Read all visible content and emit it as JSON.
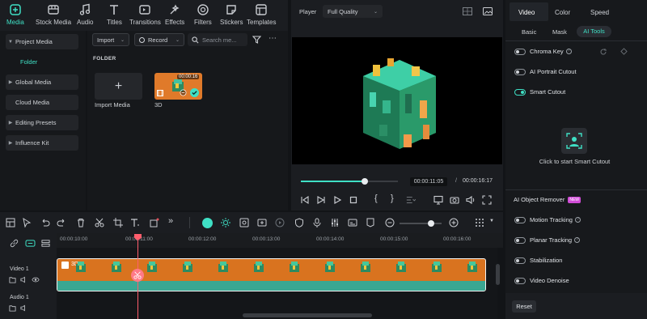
{
  "toolbar": {
    "items": [
      {
        "label": "Media",
        "icon": "media-icon",
        "active": true
      },
      {
        "label": "Stock Media",
        "icon": "stock-media-icon",
        "active": false
      },
      {
        "label": "Audio",
        "icon": "music-note-icon",
        "active": false
      },
      {
        "label": "Titles",
        "icon": "text-t-icon",
        "active": false
      },
      {
        "label": "Transitions",
        "icon": "transitions-icon",
        "active": false
      },
      {
        "label": "Effects",
        "icon": "effects-icon",
        "active": false
      },
      {
        "label": "Filters",
        "icon": "filters-icon",
        "active": false
      },
      {
        "label": "Stickers",
        "icon": "stickers-icon",
        "active": false
      },
      {
        "label": "Templates",
        "icon": "templates-icon",
        "active": false
      }
    ]
  },
  "leftnav": {
    "items": [
      "Project Media",
      "Folder",
      "Global Media",
      "Cloud Media",
      "Editing Presets",
      "Influence Kit"
    ]
  },
  "media": {
    "import_label": "Import",
    "record_label": "Record",
    "search_placeholder": "Search me...",
    "folder_heading": "FOLDER",
    "import_tile_label": "Import Media",
    "clip_label": "3D",
    "clip_duration": "00:00:16"
  },
  "player": {
    "label": "Player",
    "quality": "Full Quality",
    "current_time": "00:00:11:05",
    "separator": "/",
    "total_time": "00:00:16:17",
    "progress": 0.66
  },
  "rpanel": {
    "tabs": [
      "Video",
      "Color",
      "Speed"
    ],
    "subtabs": [
      "Basic",
      "Mask",
      "AI Tools"
    ],
    "chroma_key": "Chroma Key",
    "ai_portrait": "AI Portrait Cutout",
    "smart_cutout": "Smart Cutout",
    "smart_cutout_prompt": "Click to start Smart Cutout",
    "ai_remover": "AI Object Remover",
    "new_badge": "NEW",
    "motion_tracking": "Motion Tracking",
    "planar_tracking": "Planar Tracking",
    "stabilization": "Stabilization",
    "video_denoise": "Video Denoise",
    "reset": "Reset",
    "accent": "#3fe0c5"
  },
  "timeline": {
    "ruler": [
      "00:00:10:00",
      "00:00:11:00",
      "00:00:12:00",
      "00:00:13:00",
      "00:00:14:00",
      "00:00:15:00",
      "00:00:16:00"
    ],
    "video_track": "Video 1",
    "audio_track": "Audio 1",
    "clip_label": "3D",
    "zoom": 0.75
  }
}
